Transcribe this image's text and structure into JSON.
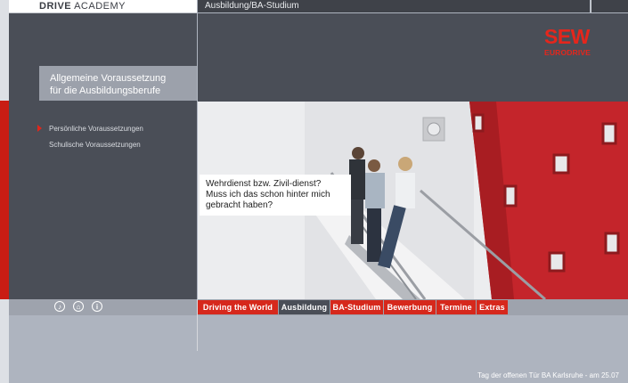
{
  "header": {
    "brand_drive": "DRIVE",
    "brand_academy": "ACADEMY",
    "section_title": "Ausbildung/BA-Studium"
  },
  "logo": {
    "main": "SEW",
    "sub": "EURODRIVE"
  },
  "sidebar": {
    "heading_line1": "Allgemeine Voraussetzung",
    "heading_line2": "für die Ausbildungsberufe",
    "items": [
      {
        "label": "Persönliche Voraussetzungen",
        "active": true
      },
      {
        "label": "Schulische Voraussetzungen",
        "active": false
      }
    ]
  },
  "speech": {
    "line1": "Wehrdienst bzw. Zivil-dienst?",
    "line2": "Muss ich das schon hinter mich",
    "line3": "gebracht haben?"
  },
  "utility_icons": [
    {
      "icon": "speaker-icon",
      "glyph": "♪"
    },
    {
      "icon": "print-icon",
      "glyph": "⌂"
    },
    {
      "icon": "info-icon",
      "glyph": "i"
    }
  ],
  "nav": {
    "tabs": [
      {
        "label": "Driving the World",
        "active": false
      },
      {
        "label": "Ausbildung",
        "active": true
      },
      {
        "label": "BA-Studium",
        "active": false
      },
      {
        "label": "Bewerbung",
        "active": false
      },
      {
        "label": "Termine",
        "active": false
      },
      {
        "label": "Extras",
        "active": false
      }
    ]
  },
  "footer": {
    "news": "Tag der offenen Tür BA Karlsruhe - am 25.07"
  },
  "colors": {
    "accent_red": "#d6281c",
    "dark_panel": "#4a4e57",
    "mid_gray": "#9ea3ad"
  }
}
